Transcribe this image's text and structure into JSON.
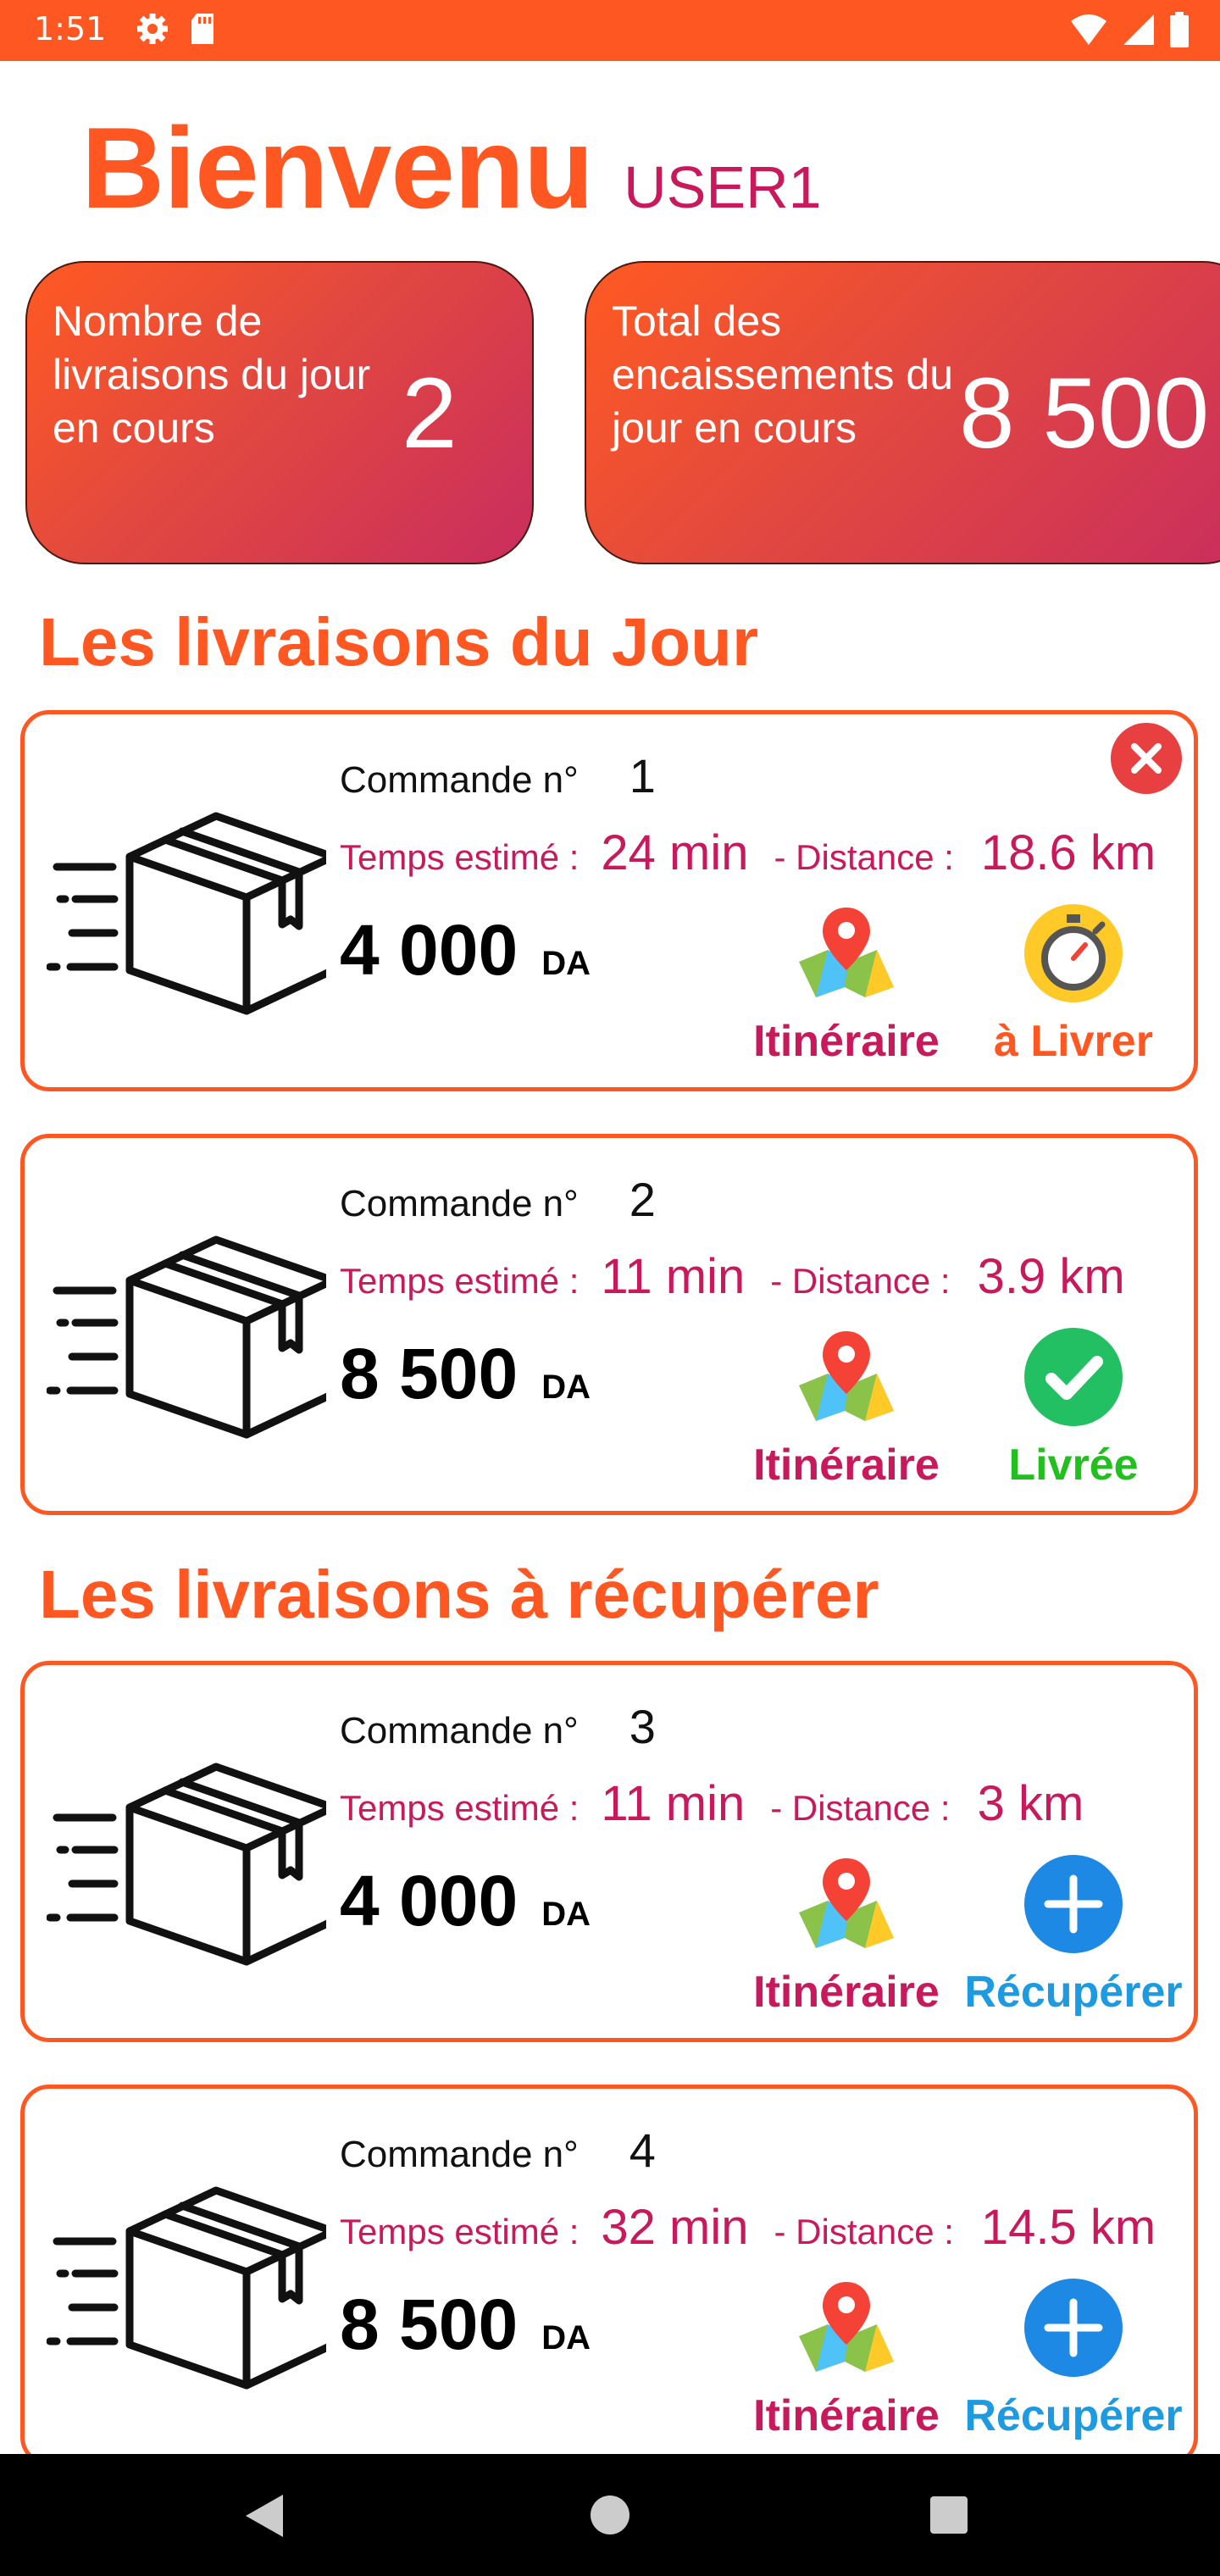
{
  "status_bar": {
    "time": "1:51",
    "left_icons": [
      "gear-icon",
      "sd-card-icon"
    ],
    "right_icons": [
      "wifi-icon",
      "signal-icon",
      "battery-icon"
    ],
    "color": "#ff5722"
  },
  "welcome": {
    "title": "Bienvenu",
    "user": "USER1"
  },
  "stats": {
    "deliveries_label": "Nombre de livraisons du jour en cours",
    "deliveries_value": "2",
    "cash_label": "Total des encaissements du jour en cours",
    "cash_value": "8 500"
  },
  "sections": {
    "today_title": "Les livraisons du Jour",
    "pickup_title": "Les livraisons à récupérer"
  },
  "today_deliveries": [
    {
      "order_label": "Commande n°",
      "order_number": "1",
      "time_label": "Temps estimé :",
      "time": "24 min",
      "distance_label": "- Distance :",
      "distance": "18.6 km",
      "price": "4 000",
      "currency": "DA",
      "map_label": "Itinéraire",
      "status_label": "à Livrer",
      "status_icon": "stopwatch-icon",
      "status_color": "#ff5722",
      "has_close": true
    },
    {
      "order_label": "Commande n°",
      "order_number": "2",
      "time_label": "Temps estimé :",
      "time": "11 min",
      "distance_label": "- Distance :",
      "distance": "3.9 km",
      "price": "8 500",
      "currency": "DA",
      "map_label": "Itinéraire",
      "status_label": "Livrée",
      "status_icon": "check-circle-icon",
      "status_color": "#22c01e",
      "has_close": false
    }
  ],
  "pickup_deliveries": [
    {
      "order_label": "Commande n°",
      "order_number": "3",
      "time_label": "Temps estimé :",
      "time": "11 min",
      "distance_label": "- Distance :",
      "distance": "3 km",
      "price": "4 000",
      "currency": "DA",
      "map_label": "Itinéraire",
      "status_label": "Récupérer",
      "status_icon": "plus-circle-icon",
      "status_color": "#1e9ae0"
    },
    {
      "order_label": "Commande n°",
      "order_number": "4",
      "time_label": "Temps estimé :",
      "time": "32 min",
      "distance_label": "- Distance :",
      "distance": "14.5 km",
      "price": "8 500",
      "currency": "DA",
      "map_label": "Itinéraire",
      "status_label": "Récupérer",
      "status_icon": "plus-circle-icon",
      "status_color": "#1e9ae0"
    }
  ],
  "nav_bar": {
    "buttons": [
      "back-icon",
      "home-icon",
      "recents-icon"
    ]
  },
  "colors": {
    "accent": "#ff5722",
    "secondary": "#c8195c",
    "map_label": "#c8195c"
  }
}
